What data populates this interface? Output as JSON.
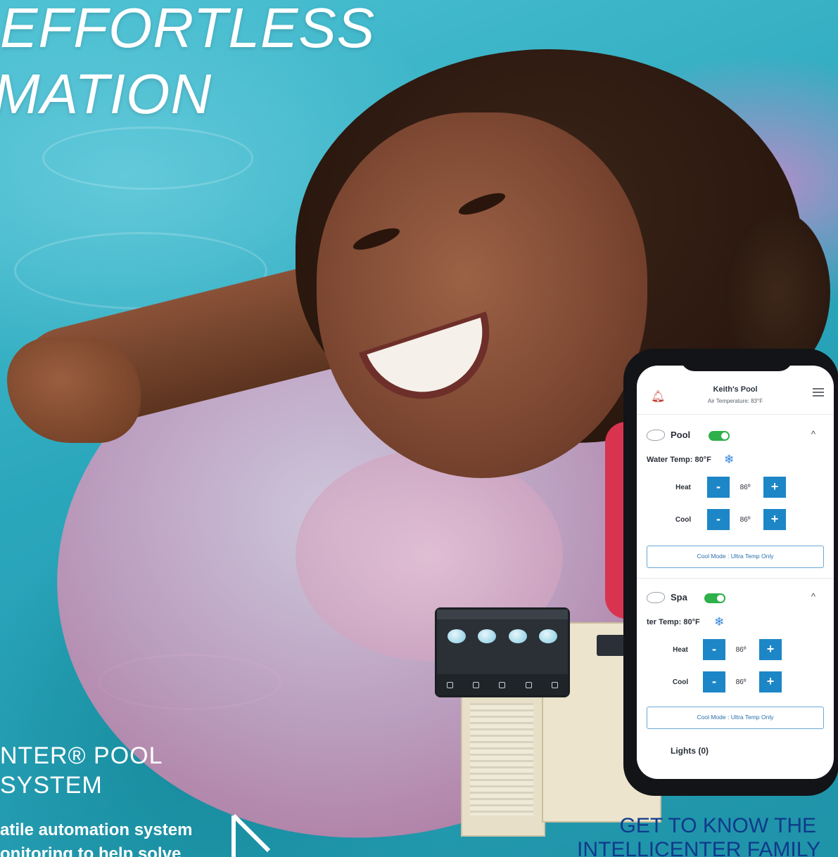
{
  "headline": {
    "line1": "EFFORTLESS",
    "line2": "MATION"
  },
  "product": {
    "title_line1": "NTER® POOL",
    "title_line2": "SYSTEM",
    "desc_line1": "atile automation system",
    "desc_line2": "onitoring to help solve"
  },
  "cta": {
    "line1": "GET TO KNOW THE",
    "line2": "INTELLICENTER FAMILY"
  },
  "app": {
    "pool_name": "Keith's Pool",
    "air_temperature": "Air Temperature: 83°F",
    "bell_icon": "bell-icon",
    "menu_icon": "hamburger-menu-icon",
    "sections": [
      {
        "label": "Pool",
        "toggle_on": true,
        "water_temp": "Water Temp: 80°F",
        "heat_label": "Heat",
        "heat_value": "86º",
        "cool_label": "Cool",
        "cool_value": "86º",
        "mode": "Cool Mode : Ultra Temp Only"
      },
      {
        "label": "Spa",
        "toggle_on": true,
        "water_temp": "ter Temp: 80°F",
        "heat_label": "Heat",
        "heat_value": "86º",
        "cool_label": "Cool",
        "cool_value": "86º",
        "mode": "Cool Mode : Ultra Temp Only"
      }
    ],
    "lights_label": "Lights (0)",
    "minus": "-",
    "plus": "+",
    "caret": "^",
    "snow_glyph": "❄"
  },
  "colors": {
    "cta": "#0f3a8c",
    "button_blue": "#1d86c7",
    "toggle_green": "#2eb04a"
  }
}
